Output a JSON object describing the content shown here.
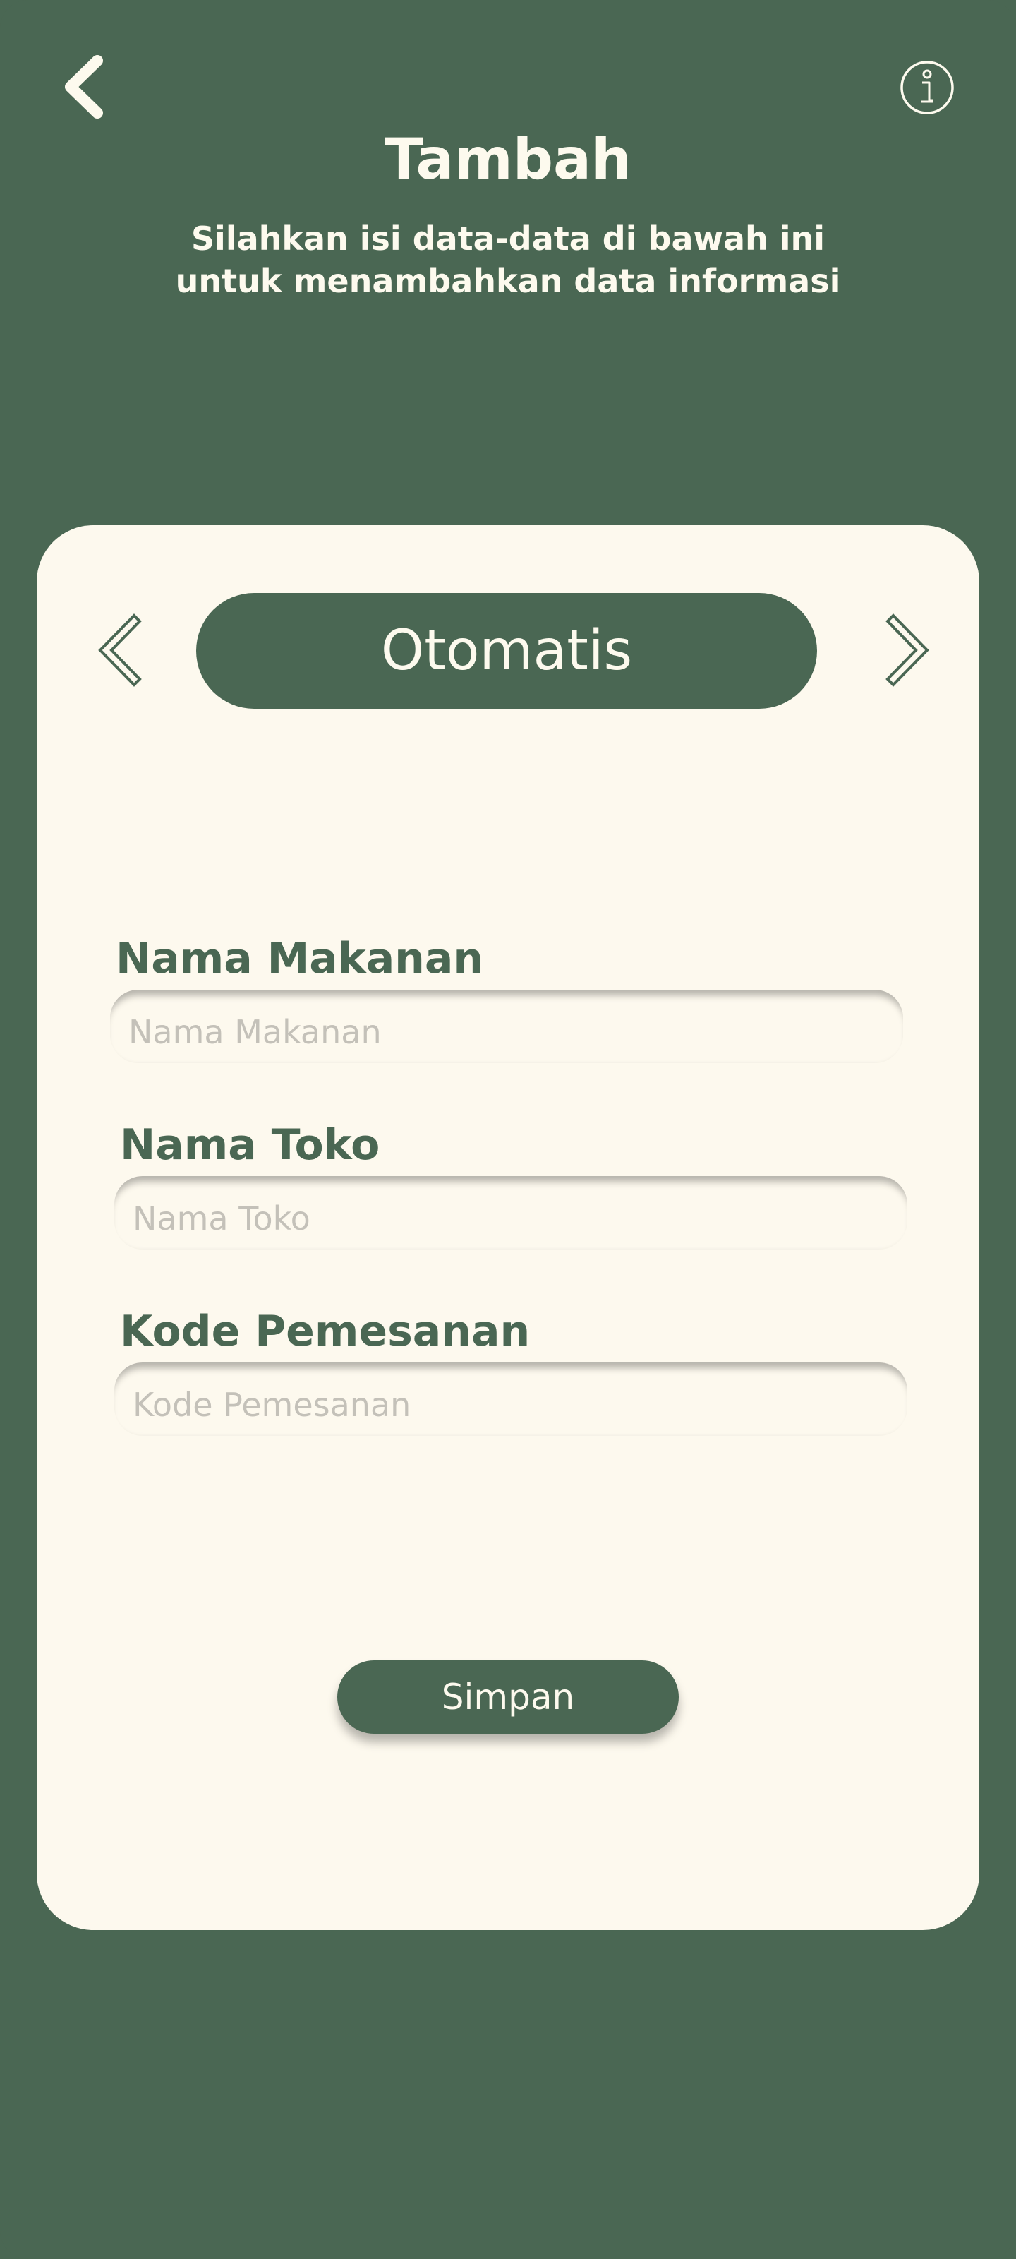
{
  "header": {
    "title": "Tambah",
    "subtitle": "Silahkan isi data-data di bawah ini untuk menambahkan data informasi",
    "back_icon": "chevron-left-icon",
    "info_icon": "info-icon"
  },
  "mode_selector": {
    "value": "Otomatis",
    "prev_icon": "chevron-left-icon",
    "next_icon": "chevron-right-icon"
  },
  "form": {
    "fields": [
      {
        "label": "Nama Makanan",
        "placeholder": "Nama Makanan",
        "value": ""
      },
      {
        "label": "Nama Toko",
        "placeholder": "Nama Toko",
        "value": ""
      },
      {
        "label": "Kode Pemesanan",
        "placeholder": "Kode Pemesanan",
        "value": ""
      }
    ],
    "submit_label": "Simpan"
  },
  "colors": {
    "primary": "#4a6753",
    "card": "#fdf9ee",
    "text_light": "#fdfaee",
    "placeholder": "#c4c1b9"
  }
}
